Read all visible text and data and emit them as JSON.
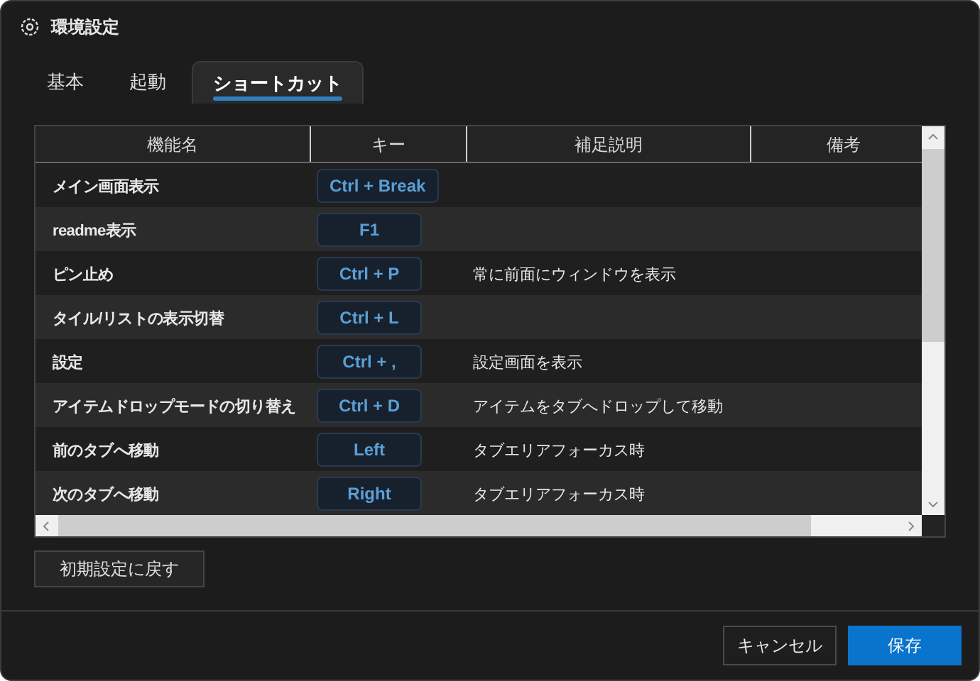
{
  "window": {
    "title": "環境設定"
  },
  "tabs": [
    {
      "label": "基本",
      "selected": false
    },
    {
      "label": "起動",
      "selected": false
    },
    {
      "label": "ショートカット",
      "selected": true
    }
  ],
  "table": {
    "columns": [
      "機能名",
      "キー",
      "補足説明",
      "備考"
    ],
    "rows": [
      {
        "name": "メイン画面表示",
        "key": "Ctrl + Break"
      },
      {
        "name": "readme表示",
        "key": "F1"
      },
      {
        "name": "ピン止め",
        "key": "Ctrl + P",
        "description": "常に前面にウィンドウを表示"
      },
      {
        "name": "タイル/リストの表示切替",
        "key": "Ctrl + L"
      },
      {
        "name": "設定",
        "key": "Ctrl + ,",
        "description": "設定画面を表示"
      },
      {
        "name": "アイテムドロップモードの切り替え",
        "key": "Ctrl + D",
        "description": "アイテムをタブへドロップして移動"
      },
      {
        "name": "前のタブへ移動",
        "key": "Left",
        "description": "タブエリアフォーカス時"
      },
      {
        "name": "次のタブへ移動",
        "key": "Right",
        "description": "タブエリアフォーカス時"
      }
    ]
  },
  "reset_button": "初期設定に戻す",
  "footer_buttons": [
    {
      "label": "キャンセル",
      "kind": "secondary"
    },
    {
      "label": "保存",
      "kind": "primary"
    }
  ]
}
